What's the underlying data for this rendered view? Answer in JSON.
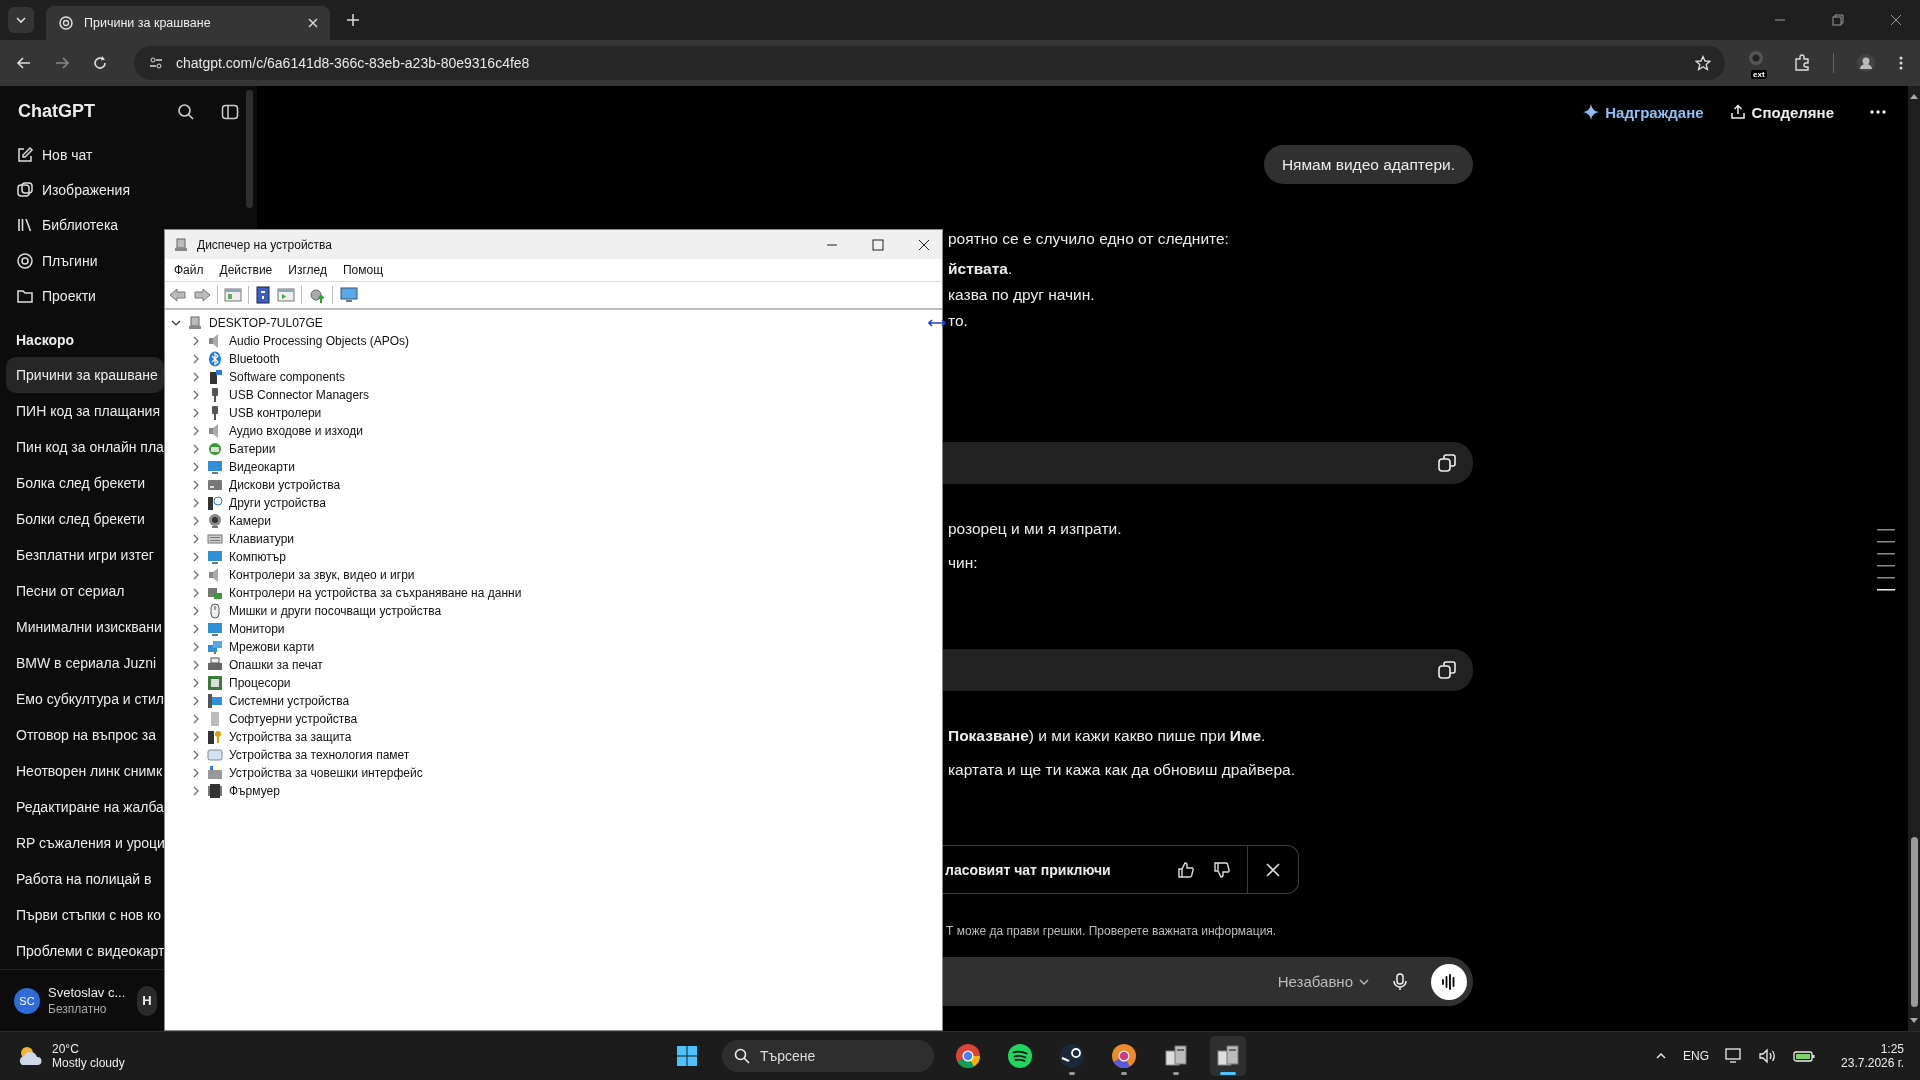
{
  "browser": {
    "tab": {
      "title": "Причини за крашване"
    },
    "url": "chatgpt.com/c/6a6141d8-366c-83eb-a23b-80e9316c4fe8",
    "extension_badge": "ext"
  },
  "sidebar": {
    "brand": "ChatGPT",
    "nav": [
      "Нов чат",
      "Изображения",
      "Библиотека",
      "Плъгини",
      "Проекти"
    ],
    "section_title": "Наскоро",
    "history": [
      {
        "title": "Причини за крашване",
        "selected": true
      },
      {
        "title": "ПИН код за плащания",
        "selected": false
      },
      {
        "title": "Пин код за онлайн пла",
        "selected": false
      },
      {
        "title": "Болка след брекети",
        "selected": false
      },
      {
        "title": "Болки след брекети",
        "selected": false
      },
      {
        "title": "Безплатни игри изтег",
        "selected": false
      },
      {
        "title": "Песни от сериал",
        "selected": false
      },
      {
        "title": "Минимални изисквани",
        "selected": false
      },
      {
        "title": "BMW в сериала Juzni",
        "selected": false
      },
      {
        "title": "Емо субкултура и стил",
        "selected": false
      },
      {
        "title": "Отговор на въпрос за",
        "selected": false
      },
      {
        "title": "Неотворен линк снимк",
        "selected": false
      },
      {
        "title": "Редактиране на жалба",
        "selected": false
      },
      {
        "title": "RP съжаления и уроци",
        "selected": false
      },
      {
        "title": "Работа на полицай в",
        "selected": false
      },
      {
        "title": "Първи стъпки с нов ко",
        "selected": false
      },
      {
        "title": "Проблеми с видеокарт",
        "selected": false
      }
    ],
    "user": {
      "initials": "SC",
      "name": "Svetoslav c...",
      "plan": "Безплатно",
      "button": "Н"
    }
  },
  "header": {
    "upgrade": "Надграждане",
    "share": "Споделяне"
  },
  "chat": {
    "user_message": "Нямам видео адаптери.",
    "blocks": [
      {
        "kind": "text",
        "text": "роятно се е случило едно от следните:"
      },
      {
        "kind": "text",
        "text": "**йствата**."
      },
      {
        "kind": "text",
        "text": "казва по друг начин."
      },
      {
        "kind": "text",
        "text": "то."
      },
      {
        "kind": "code"
      },
      {
        "kind": "text",
        "text": "розорец и ми я изпрати."
      },
      {
        "kind": "text",
        "text": "чин:"
      },
      {
        "kind": "code"
      },
      {
        "kind": "text",
        "text": "**Показване**) и ми кажи какво пише при **Име**."
      },
      {
        "kind": "text",
        "text": "картата и ще ти кажа как да обновиш драйвера."
      }
    ],
    "voice_banner": "ласовият чат приключи",
    "disclaimer": "Т може да прави грешки. Проверете важната информация.",
    "composer": {
      "mode": "Незабавно"
    }
  },
  "device_manager": {
    "title": "Диспечер на устройства",
    "menu": [
      "Файл",
      "Действие",
      "Изглед",
      "Помощ"
    ],
    "root": {
      "label": "DESKTOP-7UL07GE",
      "expanded": true,
      "children": [
        {
          "label": "Audio Processing Objects (APOs)",
          "expanded": false
        },
        {
          "label": "Bluetooth",
          "expanded": false
        },
        {
          "label": "Software components",
          "expanded": false
        },
        {
          "label": "USB Connector Managers",
          "expanded": false
        },
        {
          "label": "USB контролери",
          "expanded": false
        },
        {
          "label": "Аудио входове и изходи",
          "expanded": false
        },
        {
          "label": "Батерии",
          "expanded": false
        },
        {
          "label": "Видеокарти",
          "expanded": false
        },
        {
          "label": "Дискови устройства",
          "expanded": false
        },
        {
          "label": "Други устройства",
          "expanded": false
        },
        {
          "label": "Камери",
          "expanded": false
        },
        {
          "label": "Клавиатури",
          "expanded": false
        },
        {
          "label": "Компютър",
          "expanded": false
        },
        {
          "label": "Контролери за звук, видео и игри",
          "expanded": false
        },
        {
          "label": "Контролери на устройства за съхраняване на данни",
          "expanded": false
        },
        {
          "label": "Мишки и други посочващи устройства",
          "expanded": false
        },
        {
          "label": "Монитори",
          "expanded": false
        },
        {
          "label": "Мрежови карти",
          "expanded": false
        },
        {
          "label": "Опашки за печат",
          "expanded": false
        },
        {
          "label": "Процесори",
          "expanded": false
        },
        {
          "label": "Системни устройства",
          "expanded": false
        },
        {
          "label": "Софтуерни устройства",
          "expanded": false
        },
        {
          "label": "Устройства за защита",
          "expanded": false
        },
        {
          "label": "Устройства за технология памет",
          "expanded": false
        },
        {
          "label": "Устройства за човешки интерфейс",
          "expanded": false
        },
        {
          "label": "Фърмуер",
          "expanded": false
        }
      ]
    }
  },
  "taskbar": {
    "weather": {
      "temp": "20°C",
      "condition": "Mostly cloudy"
    },
    "search_placeholder": "Търсене",
    "apps": [
      {
        "kind": "chrome",
        "running": false,
        "selected": false
      },
      {
        "kind": "spotify",
        "running": false,
        "selected": false
      },
      {
        "kind": "steam",
        "running": true,
        "selected": false
      },
      {
        "kind": "chrome-color",
        "running": true,
        "selected": false
      },
      {
        "kind": "devmgr",
        "running": true,
        "selected": false
      },
      {
        "kind": "devmgr",
        "running": true,
        "selected": true
      }
    ],
    "language": "ENG",
    "time": "1:25",
    "date": "23.7.2026 г."
  }
}
